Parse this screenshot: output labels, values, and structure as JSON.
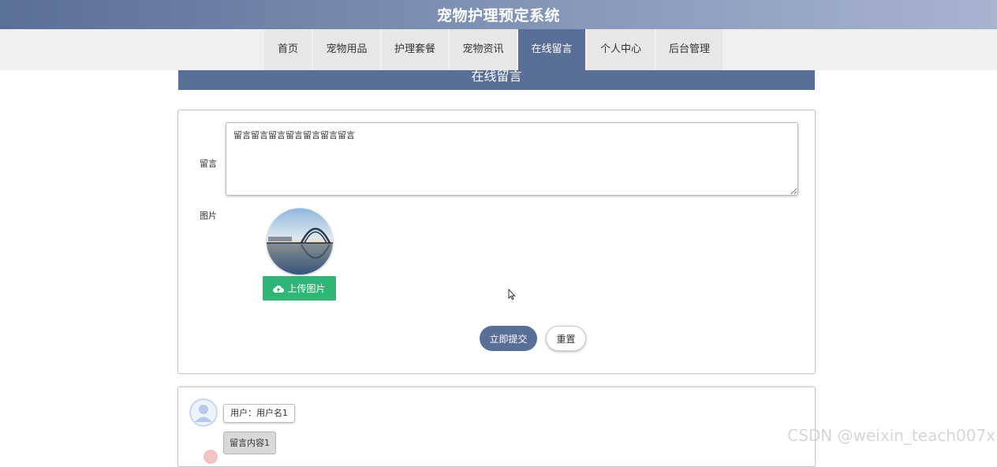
{
  "header": {
    "title": "宠物护理预定系统"
  },
  "nav": {
    "items": [
      {
        "label": "首页",
        "active": false
      },
      {
        "label": "宠物用品",
        "active": false
      },
      {
        "label": "护理套餐",
        "active": false
      },
      {
        "label": "宠物资讯",
        "active": false
      },
      {
        "label": "在线留言",
        "active": true
      },
      {
        "label": "个人中心",
        "active": false
      },
      {
        "label": "后台管理",
        "active": false
      }
    ]
  },
  "section": {
    "title": "在线留言"
  },
  "form": {
    "message_label": "留言",
    "message_value": "留言留言留言留言留言留言留言",
    "image_label": "图片",
    "upload_label": "上传图片",
    "submit_label": "立即提交",
    "reset_label": "重置"
  },
  "comments": [
    {
      "user": "用户：用户名1",
      "content": "留言内容1"
    }
  ],
  "watermark": "CSDN @weixin_teach007x",
  "colors": {
    "primary": "#5a6f98",
    "upload": "#2fb676"
  }
}
